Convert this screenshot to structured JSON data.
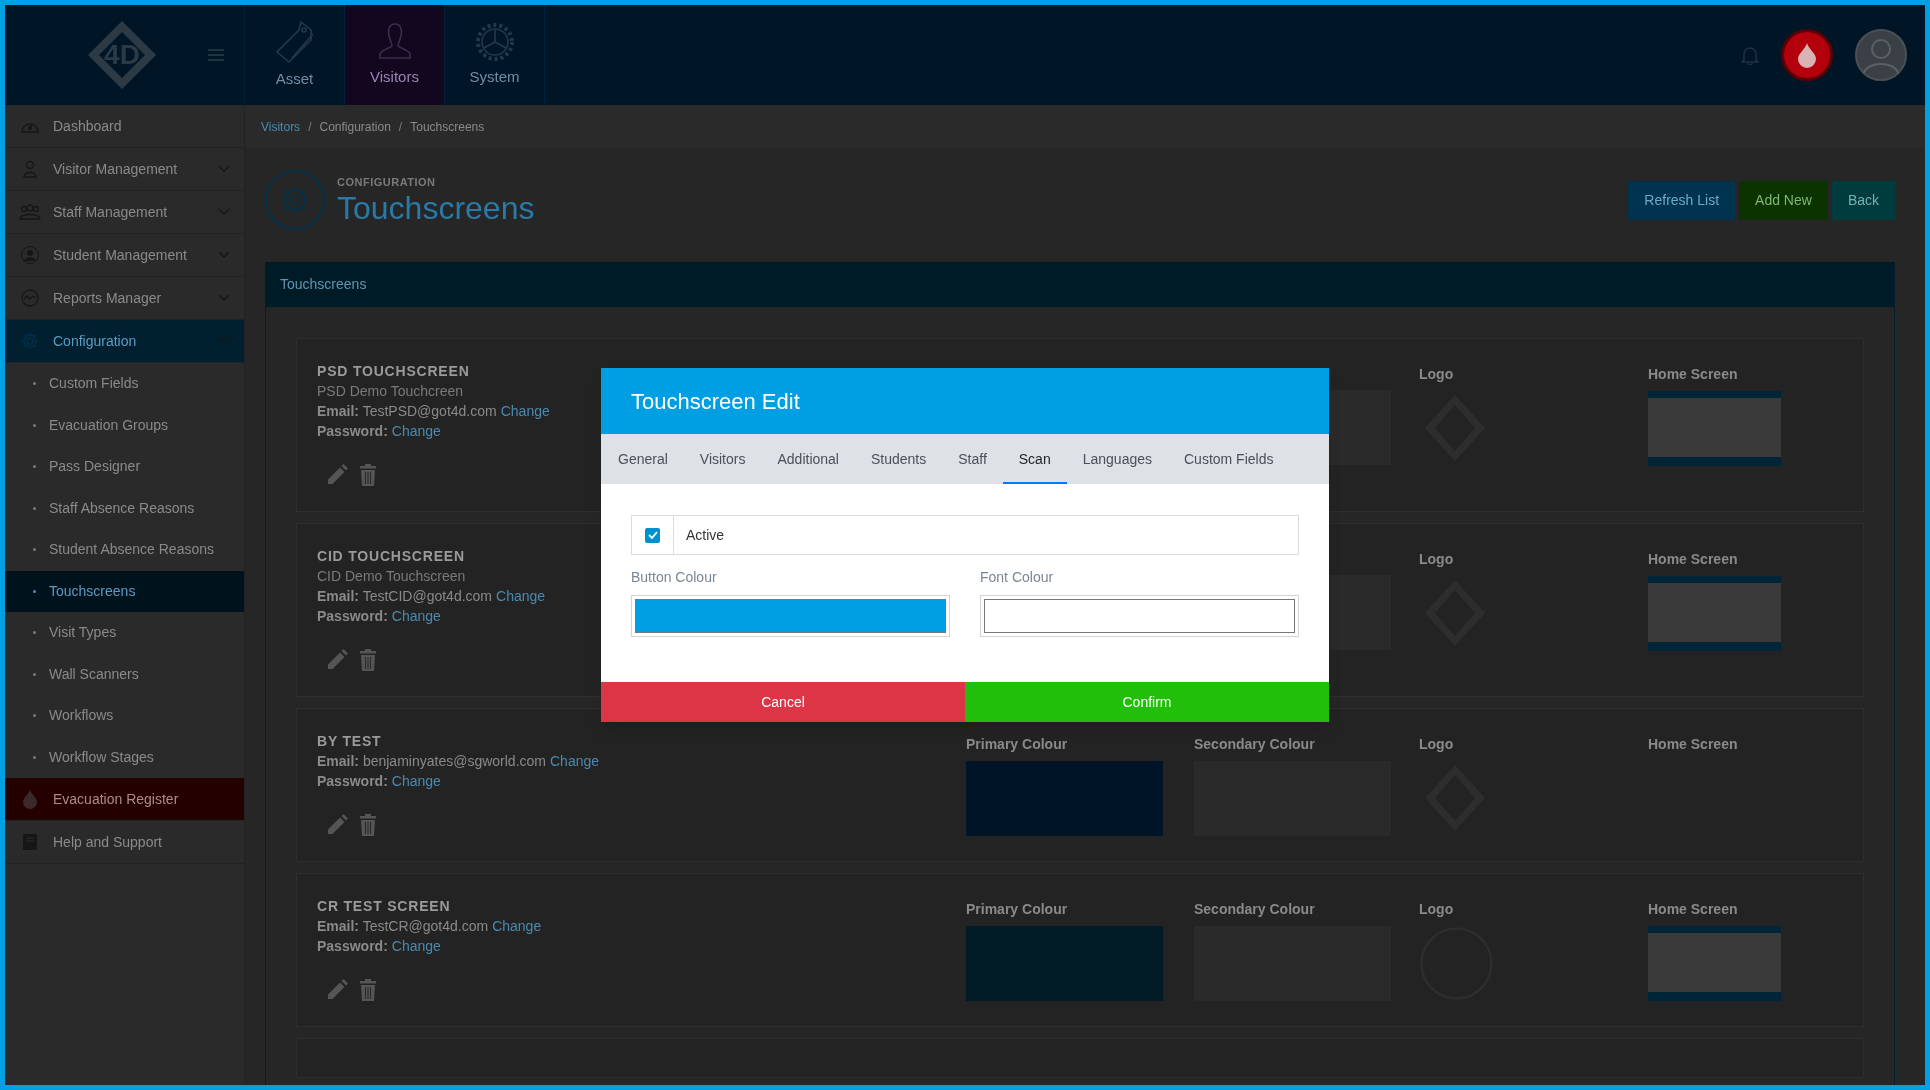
{
  "top_bar": {
    "logo_text": "4D",
    "nav": [
      {
        "label": "Asset",
        "selected": false
      },
      {
        "label": "Visitors",
        "selected": true
      },
      {
        "label": "System",
        "selected": false
      }
    ]
  },
  "sidebar": {
    "items": [
      {
        "label": "Dashboard",
        "kind": "link",
        "selected": false
      },
      {
        "label": "Visitor Management",
        "kind": "menu",
        "selected": false
      },
      {
        "label": "Staff Management",
        "kind": "menu",
        "selected": false
      },
      {
        "label": "Student Management",
        "kind": "menu",
        "selected": false
      },
      {
        "label": "Reports Manager",
        "kind": "menu",
        "selected": false
      },
      {
        "label": "Configuration",
        "kind": "menu",
        "selected": true
      },
      {
        "label": "Custom Fields",
        "kind": "sub",
        "selected": false
      },
      {
        "label": "Evacuation Groups",
        "kind": "sub",
        "selected": false
      },
      {
        "label": "Pass Designer",
        "kind": "sub",
        "selected": false
      },
      {
        "label": "Staff Absence Reasons",
        "kind": "sub",
        "selected": false
      },
      {
        "label": "Student Absence Reasons",
        "kind": "sub",
        "selected": false
      },
      {
        "label": "Touchscreens",
        "kind": "sub",
        "selected": true
      },
      {
        "label": "Visit Types",
        "kind": "sub",
        "selected": false
      },
      {
        "label": "Wall Scanners",
        "kind": "sub",
        "selected": false
      },
      {
        "label": "Workflows",
        "kind": "sub",
        "selected": false
      },
      {
        "label": "Workflow Stages",
        "kind": "sub",
        "selected": false
      },
      {
        "label": "Evacuation Register",
        "kind": "alert",
        "selected": false
      },
      {
        "label": "Help and Support",
        "kind": "link",
        "selected": false
      }
    ]
  },
  "breadcrumb": [
    {
      "label": "Visitors",
      "kind": "link"
    },
    {
      "separator": "/",
      "label": "Configuration",
      "kind": "text"
    },
    {
      "separator": "/",
      "label": "Touchscreens",
      "kind": "text"
    }
  ],
  "page_header": {
    "kicker": "CONFIGURATION",
    "title": "Touchscreens",
    "buttons": [
      {
        "label": "Refresh List",
        "kind": "primary"
      },
      {
        "label": "Add New",
        "kind": "success"
      },
      {
        "label": "Back",
        "kind": "secondary"
      }
    ]
  },
  "panel": {
    "title": "Touchscreens",
    "cards": [
      {
        "name": "PSD TOUCHSCREEN",
        "description": "PSD Demo Touchcreen",
        "email": "**Email:** TestPSD@got4d.com",
        "email_link": "Change",
        "password": "**Password:**",
        "password_link": "Change",
        "columns": [
          {
            "kind": "blank"
          },
          {
            "kind": "swatch",
            "color": "#2a2a2a"
          },
          {
            "kind": "logo_diamond",
            "label": "Logo"
          },
          {
            "kind": "photo",
            "label": "Home Screen"
          }
        ]
      },
      {
        "name": "CID TOUCHSCREEN",
        "description": "CID Demo Touchscreen",
        "email": "**Email:** TestCID@got4d.com",
        "email_link": "Change",
        "password": "**Password:**",
        "password_link": "Change",
        "columns": [
          {
            "kind": "blank"
          },
          {
            "kind": "swatch",
            "color": "#2a2a2a"
          },
          {
            "kind": "logo_diamond",
            "label": "Logo"
          },
          {
            "kind": "photo",
            "label": "Home Screen"
          }
        ]
      },
      {
        "name": "BY TEST",
        "email": "**Email:** benjaminyates@sgworld.com",
        "email_link": "Change",
        "password": "**Password:**",
        "password_link": "Change",
        "columns": [
          {
            "kind": "swatch",
            "label": "Primary Colour",
            "color": "#001428"
          },
          {
            "kind": "swatch",
            "label": "Secondary Colour",
            "color": "#2a2a2a"
          },
          {
            "kind": "logo_diamond",
            "label": "Logo"
          },
          {
            "kind": "empty",
            "label": "Home Screen"
          }
        ]
      },
      {
        "name": "CR TEST SCREEN",
        "email": "**Email:** TestCR@got4d.com",
        "email_link": "Change",
        "password": "**Password:**",
        "password_link": "Change",
        "columns": [
          {
            "kind": "swatch",
            "label": "Primary Colour",
            "color": "#001a26"
          },
          {
            "kind": "swatch",
            "label": "Secondary Colour",
            "color": "#2a2a2a"
          },
          {
            "kind": "logo_circle",
            "label": "Logo"
          },
          {
            "kind": "photo",
            "label": "Home Screen"
          }
        ]
      }
    ]
  },
  "modal": {
    "title": "Touchscreen Edit",
    "tabs": [
      {
        "label": "General",
        "selected": false
      },
      {
        "label": "Visitors",
        "selected": false
      },
      {
        "label": "Additional",
        "selected": false
      },
      {
        "label": "Students",
        "selected": false
      },
      {
        "label": "Staff",
        "selected": false
      },
      {
        "label": "Scan",
        "selected": true
      },
      {
        "label": "Languages",
        "selected": false
      },
      {
        "label": "Custom Fields",
        "selected": false
      }
    ],
    "active": {
      "label": "Active",
      "checked": true
    },
    "fields": [
      {
        "label": "Button Colour",
        "color": "#009fe3"
      },
      {
        "label": "Font Colour",
        "color": "#ffffff"
      }
    ],
    "buttons": [
      {
        "label": "Cancel",
        "kind": "danger"
      },
      {
        "label": "Confirm",
        "kind": "success"
      }
    ]
  }
}
